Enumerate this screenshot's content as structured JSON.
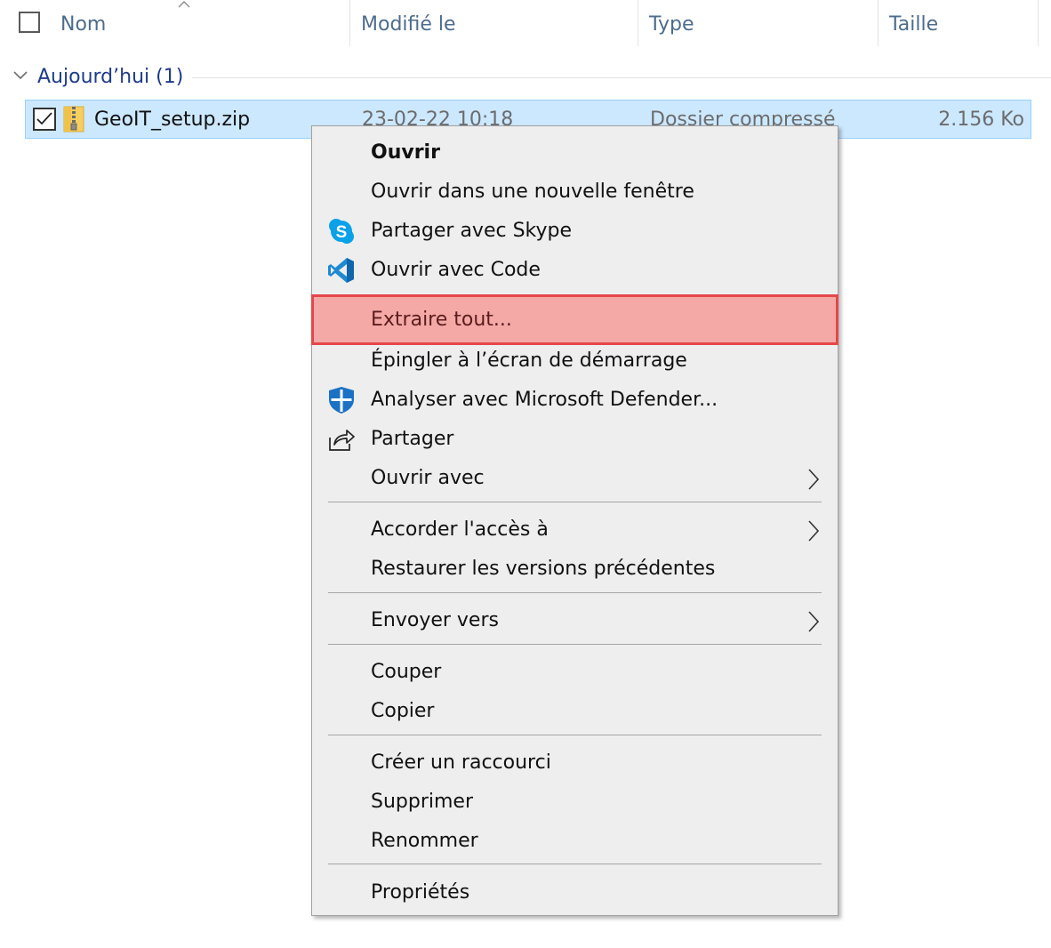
{
  "columns": {
    "name": "Nom",
    "modified": "Modifié le",
    "type": "Type",
    "size": "Taille"
  },
  "group": {
    "label": "Aujourd’hui (1)"
  },
  "file": {
    "name": "GeoIT_setup.zip",
    "modified": "23-02-22 10:18",
    "type": "Dossier compressé",
    "size": "2.156 Ko",
    "checked": true
  },
  "menu": {
    "items": {
      "open": "Ouvrir",
      "open_new_window": "Ouvrir dans une nouvelle fenêtre",
      "share_skype": "Partager avec Skype",
      "open_code": "Ouvrir avec Code",
      "extract_all": "Extraire tout...",
      "pin_start": "Épingler à l’écran de démarrage",
      "scan_defender": "Analyser avec Microsoft Defender...",
      "share": "Partager",
      "open_with": "Ouvrir avec",
      "give_access": "Accorder l'accès à",
      "restore_versions": "Restaurer les versions précédentes",
      "send_to": "Envoyer vers",
      "cut": "Couper",
      "copy": "Copier",
      "create_shortcut": "Créer un raccourci",
      "delete": "Supprimer",
      "rename": "Renommer",
      "properties": "Propriétés"
    },
    "icons": {
      "share_skype": "skype-icon",
      "open_code": "vscode-icon",
      "scan_defender": "defender-shield-icon",
      "share": "share-icon"
    },
    "highlighted_item": "extract_all"
  },
  "colors": {
    "selection_bg": "#cce8ff",
    "selection_border": "#99d1ff",
    "highlight_bg": "#f4a9a6",
    "highlight_border": "#e5474b",
    "group_text": "#1e3c8a",
    "header_text": "#4d6c8c",
    "menu_bg": "#eeeeee",
    "skype_blue": "#0aa1e8",
    "vscode_blue": "#1f8ad2",
    "defender_blue": "#1b72c4"
  }
}
